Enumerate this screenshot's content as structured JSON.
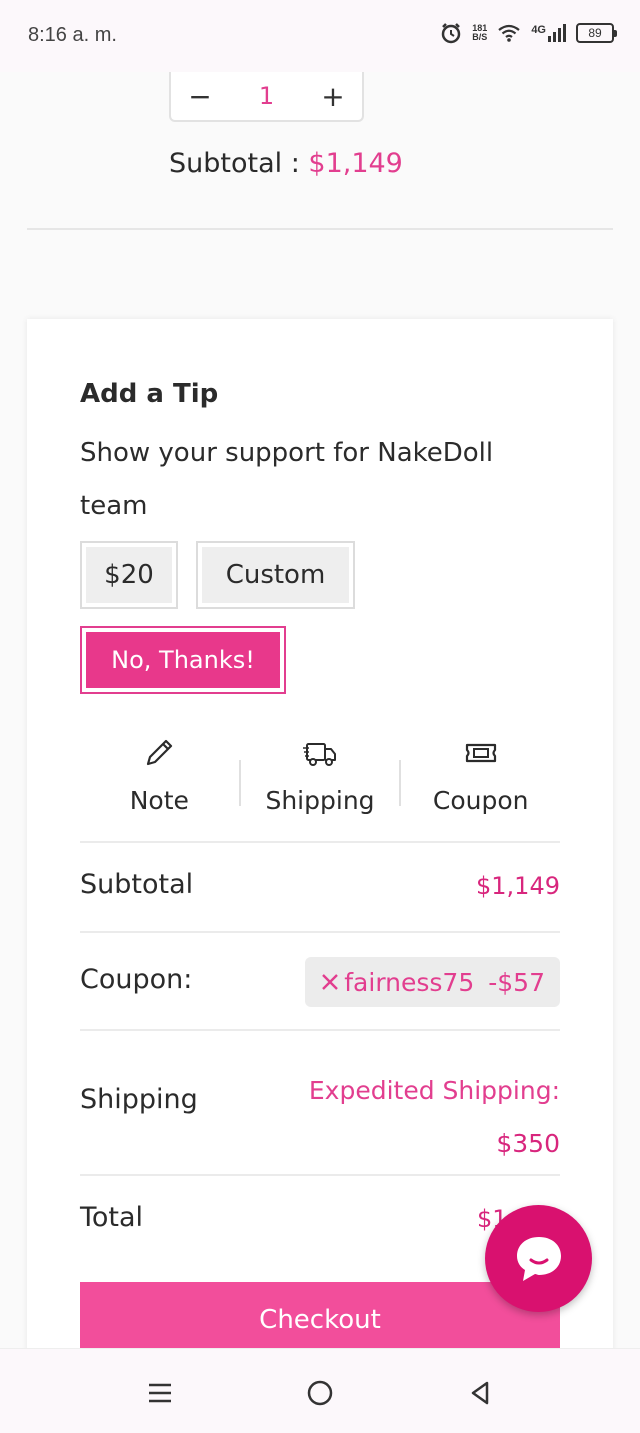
{
  "status_bar": {
    "time": "8:16 a. m.",
    "net_speed_value": "181",
    "net_speed_unit": "B/S",
    "network": "4G",
    "battery": "89"
  },
  "cart_item": {
    "quantity": "1",
    "subtotal_label": "Subtotal : ",
    "subtotal_value": "$1,149"
  },
  "tip": {
    "title": "Add a Tip",
    "description": "Show your support for NakeDoll team",
    "options": [
      "$20",
      "Custom"
    ],
    "decline_label": "No, Thanks!"
  },
  "actions": [
    {
      "label": "Note",
      "icon": "pencil-icon"
    },
    {
      "label": "Shipping",
      "icon": "truck-icon"
    },
    {
      "label": "Coupon",
      "icon": "ticket-icon"
    }
  ],
  "summary": {
    "subtotal_label": "Subtotal",
    "subtotal_value": "$1,149",
    "coupon_label": "Coupon:",
    "coupon_code": "fairness75",
    "coupon_discount": "-$57",
    "shipping_label": "Shipping",
    "shipping_method": "Expedited Shipping:",
    "shipping_value": "$350",
    "total_label": "Total",
    "total_value_visible": "$1"
  },
  "checkout_label": "Checkout",
  "colors": {
    "accent": "#e23e8f",
    "accent_dark": "#d9116f",
    "button_pink": "#f24e9b"
  }
}
